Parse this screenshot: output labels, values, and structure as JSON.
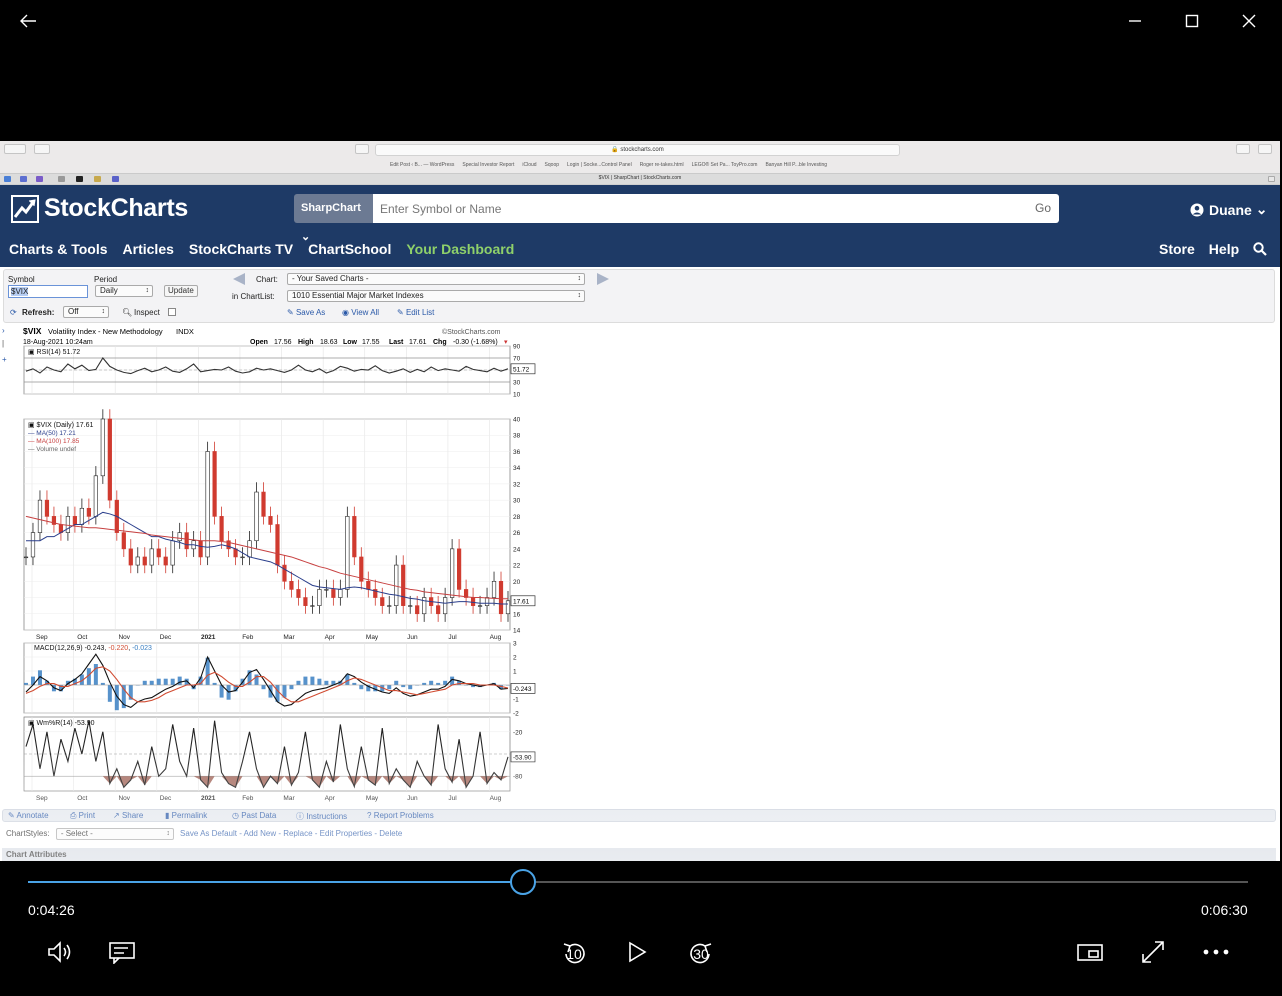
{
  "browser": {
    "url": "stockcharts.com",
    "bookmarks": [
      "Edit Post ‹ B... — WordPress",
      "Special Investor Report",
      "iCloud",
      "Sqoop",
      "Login | Socke...Control Panel",
      "Roger re-takes.html",
      "LEGO® Set Pa... ToyPro.com",
      "Banyan Hill P...ble Investing"
    ],
    "tab_title": "$VIX | SharpChart | StockCharts.com"
  },
  "header": {
    "logo": "StockCharts",
    "sharpchart_label": "SharpChart",
    "search_placeholder": "Enter Symbol or Name",
    "go_label": "Go",
    "user": "Duane",
    "nav": [
      "Charts & Tools",
      "Articles",
      "StockCharts TV",
      "ChartSchool",
      "Your Dashboard"
    ],
    "nav_right": [
      "Store",
      "Help"
    ]
  },
  "controls": {
    "symbol_label": "Symbol",
    "symbol_value": "$VIX",
    "period_label": "Period",
    "period_value": "Daily",
    "update_label": "Update",
    "refresh_label": "Refresh:",
    "refresh_value": "Off",
    "inspect_label": "Inspect",
    "chart_label": "Chart:",
    "chart_value": "- Your Saved Charts -",
    "chartlist_label": "in ChartList:",
    "chartlist_value": "1010 Essential Major Market Indexes",
    "save_as": "Save As",
    "view_all": "View All",
    "edit_list": "Edit List"
  },
  "chart_header": {
    "symbol": "$VIX",
    "name": "Volatility Index - New Methodology",
    "exchange": "INDX",
    "watermark": "©StockCharts.com",
    "datetime": "18-Aug-2021 10:24am",
    "open_label": "Open",
    "open": "17.56",
    "high_label": "High",
    "high": "18.63",
    "low_label": "Low",
    "low": "17.55",
    "last_label": "Last",
    "last": "17.61",
    "chg_label": "Chg",
    "chg": "-0.30 (-1.68%)"
  },
  "chart_data": [
    {
      "type": "line",
      "title": "RSI(14) 51.72",
      "ylim": [
        10,
        90
      ],
      "yticks": [
        10,
        30,
        50,
        70,
        90
      ],
      "last_label": "51.72",
      "series": [
        {
          "name": "RSI(14)",
          "values": [
            48,
            52,
            45,
            55,
            50,
            47,
            60,
            52,
            58,
            49,
            51,
            70,
            56,
            50,
            46,
            44,
            49,
            53,
            47,
            50,
            55,
            48,
            46,
            52,
            60,
            47,
            49,
            51,
            50,
            55,
            48,
            45,
            47,
            53,
            50,
            52,
            49,
            46,
            50,
            58,
            50,
            47,
            52,
            45,
            49,
            56,
            53,
            48,
            51,
            50,
            57,
            49,
            45,
            48,
            52,
            46,
            51,
            47,
            55,
            49,
            52,
            50,
            48,
            56,
            51,
            49,
            47,
            53,
            48,
            52
          ]
        }
      ]
    },
    {
      "type": "line",
      "title": "$VIX (Daily) 17.61",
      "legend": [
        "MA(50) 17.21",
        "MA(100) 17.85",
        "Volume undef"
      ],
      "ylim": [
        14,
        40
      ],
      "yticks": [
        14,
        16,
        18,
        20,
        22,
        24,
        26,
        28,
        30,
        32,
        34,
        36,
        38,
        40
      ],
      "last_label": "17.61",
      "x_categories": [
        "Sep",
        "Oct",
        "Nov",
        "Dec",
        "2021",
        "Feb",
        "Mar",
        "Apr",
        "May",
        "Jun",
        "Jul",
        "Aug"
      ],
      "series": [
        {
          "name": "$VIX",
          "values": [
            23,
            26,
            30,
            28,
            27,
            26,
            28,
            27,
            29,
            28,
            33,
            40,
            30,
            26,
            24,
            22,
            23,
            22,
            24,
            23,
            22,
            25,
            26,
            24,
            25,
            23,
            36,
            28,
            25,
            24,
            23,
            23,
            25,
            31,
            28,
            27,
            22,
            20,
            19,
            18,
            17,
            17,
            19,
            19,
            18,
            19,
            28,
            23,
            20,
            19,
            18,
            17,
            17,
            22,
            17,
            17,
            16,
            18,
            17,
            16,
            18,
            24,
            19,
            18,
            17,
            17,
            18,
            20,
            16,
            17.6
          ]
        },
        {
          "name": "MA(50)",
          "values": [
            25,
            25,
            25,
            25.5,
            25.5,
            26,
            26.5,
            27,
            27,
            27.5,
            28,
            28.5,
            28.3,
            28,
            27.5,
            27,
            26.5,
            26,
            25.5,
            25.5,
            25.2,
            25,
            24.8,
            24.5,
            24.5,
            24.3,
            24.2,
            24.3,
            24.5,
            24.3,
            24,
            23.5,
            23,
            22.8,
            22.6,
            22.4,
            22,
            21.5,
            21,
            20.5,
            20,
            19.5,
            19.3,
            19.2,
            19.1,
            19,
            19.2,
            19.3,
            19.2,
            19,
            18.8,
            18.6,
            18.4,
            18.3,
            18.1,
            17.9,
            17.8,
            17.6,
            17.5,
            17.4,
            17.3,
            17.4,
            17.5,
            17.5,
            17.4,
            17.3,
            17.3,
            17.3,
            17.2,
            17.21
          ]
        },
        {
          "name": "MA(100)",
          "values": [
            28,
            27.8,
            27.6,
            27.4,
            27.2,
            27,
            26.9,
            26.8,
            26.7,
            26.6,
            26.6,
            26.5,
            26.4,
            26.3,
            26.2,
            26.1,
            26,
            25.9,
            25.7,
            25.6,
            25.5,
            25.4,
            25.3,
            25.2,
            25.1,
            25,
            25,
            25,
            24.9,
            24.8,
            24.6,
            24.4,
            24.2,
            24,
            23.8,
            23.6,
            23.4,
            23.2,
            23,
            22.7,
            22.4,
            22.1,
            21.8,
            21.6,
            21.3,
            21,
            20.8,
            20.6,
            20.4,
            20.2,
            20,
            19.8,
            19.6,
            19.4,
            19.2,
            19,
            18.9,
            18.7,
            18.6,
            18.5,
            18.4,
            18.3,
            18.2,
            18.1,
            18,
            18,
            17.95,
            17.9,
            17.85,
            17.85
          ]
        }
      ]
    },
    {
      "type": "line",
      "title_prefix": "MACD(12,26,9)",
      "macd": "-0.243",
      "signal": "-0.220",
      "hist": "-0.023",
      "ylim": [
        -2,
        3
      ],
      "yticks": [
        -2,
        -1,
        0,
        1,
        2,
        3
      ],
      "last_label": "-0.243",
      "series": [
        {
          "name": "MACD",
          "values": [
            -0.5,
            0,
            0.6,
            0.3,
            -0.2,
            -0.4,
            0.1,
            0.4,
            0.8,
            1.5,
            2.2,
            1.4,
            0.2,
            -0.8,
            -1.4,
            -1.6,
            -1.2,
            -1,
            -0.9,
            -0.6,
            -0.3,
            -0.1,
            0.2,
            0.3,
            -0.2,
            0.5,
            2,
            1,
            0,
            -0.5,
            -0.4,
            0.2,
            0.9,
            1.1,
            0.4,
            -0.4,
            -1.2,
            -1.5,
            -1.4,
            -1,
            -0.6,
            -0.4,
            -0.3,
            -0.2,
            0,
            0.2,
            0.8,
            0.6,
            0.2,
            -0.1,
            -0.3,
            -0.5,
            -0.6,
            -0.2,
            -0.6,
            -0.8,
            -0.7,
            -0.5,
            -0.3,
            -0.3,
            -0.1,
            0.4,
            0.3,
            0.1,
            0,
            -0.1,
            0,
            0.1,
            -0.3,
            -0.243
          ]
        },
        {
          "name": "Signal",
          "values": [
            -0.6,
            -0.4,
            -0.1,
            0.1,
            0.1,
            -0.1,
            -0.1,
            0.1,
            0.3,
            0.7,
            1.2,
            1.3,
            1,
            0.4,
            -0.3,
            -0.9,
            -1.2,
            -1.2,
            -1.1,
            -0.9,
            -0.6,
            -0.4,
            -0.2,
            0,
            0,
            0.1,
            0.7,
            0.9,
            0.6,
            0.2,
            -0.1,
            -0.1,
            0.2,
            0.6,
            0.6,
            0.2,
            -0.4,
            -0.9,
            -1.2,
            -1.2,
            -1,
            -0.8,
            -0.6,
            -0.4,
            -0.2,
            0,
            0.3,
            0.5,
            0.4,
            0.2,
            0,
            -0.2,
            -0.4,
            -0.4,
            -0.5,
            -0.6,
            -0.7,
            -0.6,
            -0.5,
            -0.4,
            -0.3,
            0,
            0.1,
            0.1,
            0.1,
            0,
            0,
            0,
            -0.1,
            -0.22
          ]
        }
      ]
    },
    {
      "type": "line",
      "title": "Wm%R(14) -53.90",
      "ylim": [
        -100,
        0
      ],
      "yticks": [
        -20,
        -80
      ],
      "last_label": "-53.90",
      "x_categories": [
        "Sep",
        "Oct",
        "Nov",
        "Dec",
        "2021",
        "Feb",
        "Mar",
        "Apr",
        "May",
        "Jun",
        "Jul",
        "Aug"
      ],
      "series": [
        {
          "name": "Wm%R(14)",
          "values": [
            -40,
            -10,
            -70,
            -20,
            -80,
            -30,
            -60,
            -15,
            -50,
            -5,
            -60,
            -20,
            -90,
            -70,
            -95,
            -85,
            -60,
            -92,
            -40,
            -80,
            -70,
            -10,
            -60,
            -80,
            -15,
            -85,
            -95,
            -5,
            -75,
            -90,
            -95,
            -60,
            -20,
            -70,
            -95,
            -80,
            -90,
            -40,
            -92,
            -75,
            -20,
            -85,
            -95,
            -60,
            -88,
            -10,
            -70,
            -94,
            -40,
            -85,
            -92,
            -15,
            -90,
            -70,
            -85,
            -95,
            -60,
            -80,
            -92,
            -10,
            -70,
            -88,
            -30,
            -95,
            -80,
            -20,
            -90,
            -75,
            -85,
            -53.9
          ]
        }
      ]
    }
  ],
  "bottom_toolbar": {
    "items": [
      "Annotate",
      "Print",
      "Share",
      "Permalink",
      "Past Data",
      "Instructions",
      "Report Problems"
    ]
  },
  "chartstyles": {
    "label": "ChartStyles:",
    "select": "- Select -",
    "links": "Save As Default - Add New - Replace - Edit Properties - Delete"
  },
  "chart_attributes": "Chart Attributes",
  "player": {
    "current_time": "0:04:26",
    "total_time": "0:06:30",
    "progress": 0.406,
    "skip_back": "10",
    "skip_fwd": "30"
  }
}
